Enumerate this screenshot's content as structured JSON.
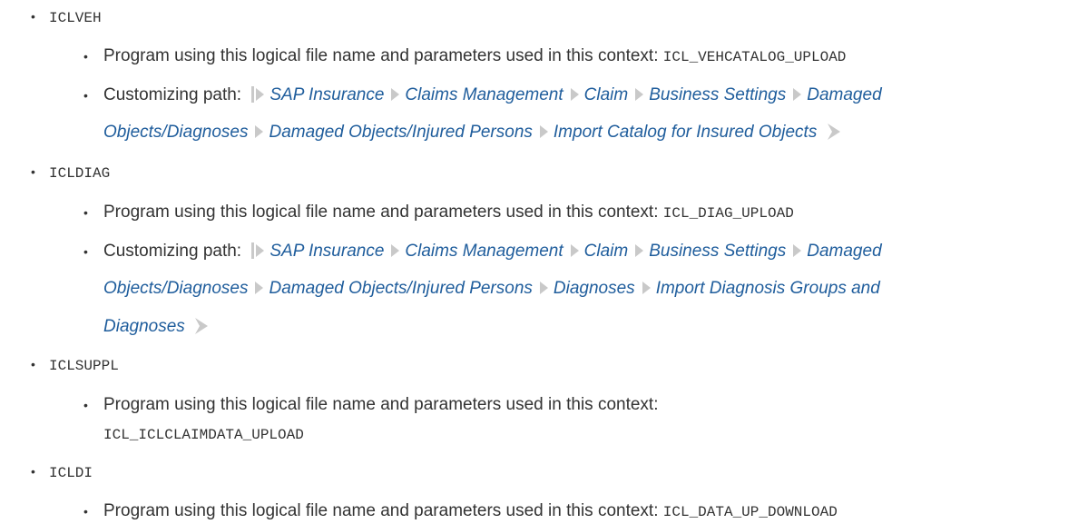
{
  "intro_label": "Program using this logical file name and parameters used in this context:",
  "customizing_label": "Customizing path:",
  "items": [
    {
      "name": "ICLVEH",
      "program": "ICL_VEHCATALOG_UPLOAD",
      "path": [
        "SAP Insurance",
        "Claims Management",
        "Claim",
        "Business Settings",
        "Damaged Objects/Diagnoses",
        "Damaged Objects/Injured Persons",
        "Import Catalog for Insured Objects"
      ]
    },
    {
      "name": "ICLDIAG",
      "program": "ICL_DIAG_UPLOAD",
      "path": [
        "SAP Insurance",
        "Claims Management",
        "Claim",
        "Business Settings",
        "Damaged Objects/Diagnoses",
        "Damaged Objects/Injured Persons",
        "Diagnoses",
        "Import Diagnosis Groups and Diagnoses"
      ]
    },
    {
      "name": "ICLSUPPL",
      "program": "ICL_ICLCLAIMDATA_UPLOAD"
    },
    {
      "name": "ICLDI",
      "program": "ICL_DATA_UP_DOWNLOAD"
    }
  ]
}
